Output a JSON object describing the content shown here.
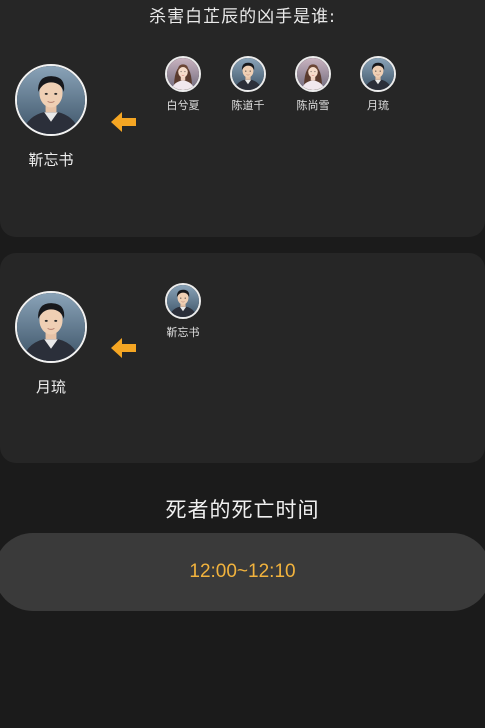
{
  "question": "杀害白芷辰的凶手是谁:",
  "groups": [
    {
      "main": {
        "name": "靳忘书",
        "avatar_icon": "man-avatar-icon"
      },
      "candidates": [
        {
          "name": "白兮夏",
          "avatar_icon": "woman-avatar-icon"
        },
        {
          "name": "陈道千",
          "avatar_icon": "man-avatar-icon"
        },
        {
          "name": "陈尚雪",
          "avatar_icon": "woman-avatar-icon"
        },
        {
          "name": "月琉",
          "avatar_icon": "man-avatar-icon"
        }
      ]
    },
    {
      "main": {
        "name": "月琉",
        "avatar_icon": "man-avatar-icon"
      },
      "candidates": [
        {
          "name": "靳忘书",
          "avatar_icon": "man-avatar-icon"
        }
      ]
    }
  ],
  "death_time": {
    "title": "死者的死亡时间",
    "value": "12:00~12:10"
  },
  "colors": {
    "background": "#1b1b1b",
    "card": "#262626",
    "accent_orange": "#f5a623",
    "time_text": "#f2b33d"
  }
}
